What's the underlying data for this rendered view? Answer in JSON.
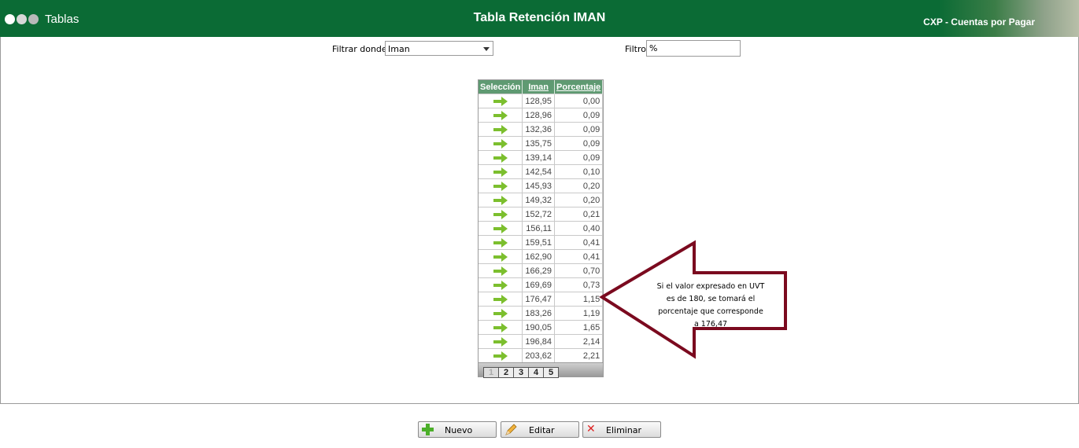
{
  "header": {
    "nav_label": "Tablas",
    "title": "Tabla Retención IMAN",
    "app_name": "CXP - Cuentas por Pagar",
    "dot_colors": [
      "#ffffff",
      "#d8d8d8",
      "#b9b9b9"
    ]
  },
  "filters": {
    "filtrar_label": "Filtrar donde",
    "filtrar_value": "Iman",
    "filtro_label": "Filtro",
    "filtro_value": "%"
  },
  "grid": {
    "columns": [
      "Selección",
      "Iman",
      "Porcentaje"
    ],
    "rows": [
      {
        "iman": "128,95",
        "porcentaje": "0,00"
      },
      {
        "iman": "128,96",
        "porcentaje": "0,09"
      },
      {
        "iman": "132,36",
        "porcentaje": "0,09"
      },
      {
        "iman": "135,75",
        "porcentaje": "0,09"
      },
      {
        "iman": "139,14",
        "porcentaje": "0,09"
      },
      {
        "iman": "142,54",
        "porcentaje": "0,10"
      },
      {
        "iman": "145,93",
        "porcentaje": "0,20"
      },
      {
        "iman": "149,32",
        "porcentaje": "0,20"
      },
      {
        "iman": "152,72",
        "porcentaje": "0,21"
      },
      {
        "iman": "156,11",
        "porcentaje": "0,40"
      },
      {
        "iman": "159,51",
        "porcentaje": "0,41"
      },
      {
        "iman": "162,90",
        "porcentaje": "0,41"
      },
      {
        "iman": "166,29",
        "porcentaje": "0,70"
      },
      {
        "iman": "169,69",
        "porcentaje": "0,73"
      },
      {
        "iman": "176,47",
        "porcentaje": "1,15"
      },
      {
        "iman": "183,26",
        "porcentaje": "1,19"
      },
      {
        "iman": "190,05",
        "porcentaje": "1,65"
      },
      {
        "iman": "196,84",
        "porcentaje": "2,14"
      },
      {
        "iman": "203,62",
        "porcentaje": "2,21"
      }
    ],
    "pages": [
      "1",
      "2",
      "3",
      "4",
      "5"
    ],
    "current_page": "1"
  },
  "callout": {
    "lines": [
      "Si el valor expresado en UVT",
      "es de 180, se tomará el",
      "porcentaje que corresponde",
      "a 176,47"
    ],
    "color": "#7b0a1f"
  },
  "buttons": {
    "nuevo": "Nuevo",
    "editar": "Editar",
    "eliminar": "Eliminar"
  }
}
